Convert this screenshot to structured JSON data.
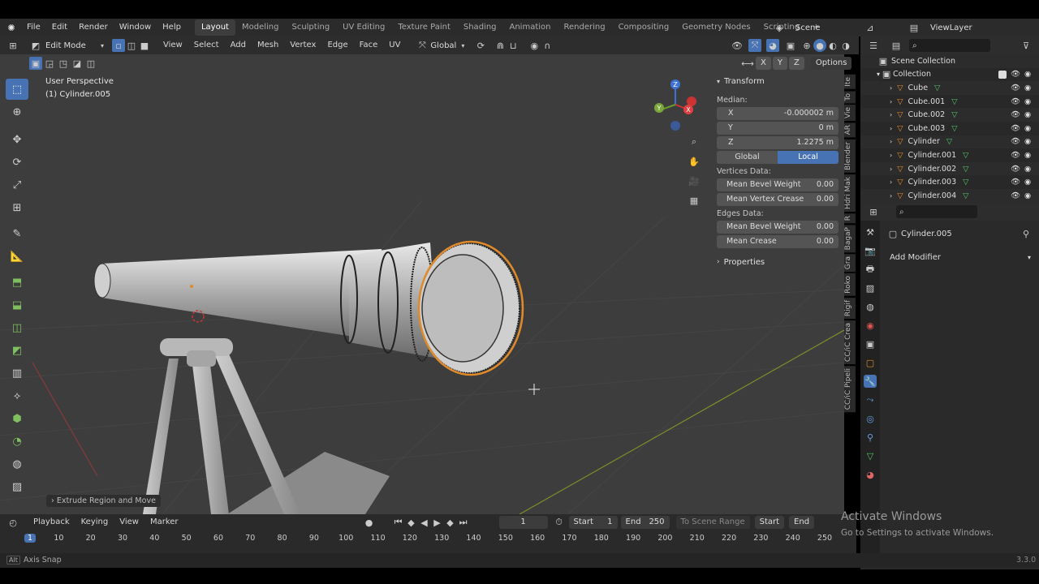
{
  "topbar": {
    "menus": [
      "File",
      "Edit",
      "Render",
      "Window",
      "Help"
    ],
    "workspaces": [
      "Layout",
      "Modeling",
      "Sculpting",
      "UV Editing",
      "Texture Paint",
      "Shading",
      "Animation",
      "Rendering",
      "Compositing",
      "Geometry Nodes",
      "Scripting"
    ],
    "active_workspace": "Layout",
    "add_icon": "+",
    "scene": "Scene",
    "view_layer": "ViewLayer"
  },
  "viewport_header": {
    "mode": "Edit Mode",
    "menus": [
      "View",
      "Select",
      "Add",
      "Mesh",
      "Vertex",
      "Edge",
      "Face",
      "UV"
    ],
    "orientation": "Global",
    "options": "Options",
    "axes": [
      "X",
      "Y",
      "Z"
    ]
  },
  "viewport": {
    "perspective": "User Perspective",
    "object": "(1) Cylinder.005",
    "last_op": "Extrude Region and Move",
    "gizmo_labels": [
      "Z",
      "Y",
      "X"
    ]
  },
  "npanel": {
    "title": "Transform",
    "median_label": "Median:",
    "median": [
      {
        "axis": "X",
        "value": "-0.000002 m"
      },
      {
        "axis": "Y",
        "value": "0 m"
      },
      {
        "axis": "Z",
        "value": "1.2275 m"
      }
    ],
    "space": [
      "Global",
      "Local"
    ],
    "active_space": "Local",
    "vertices_label": "Vertices Data:",
    "vertices": [
      {
        "label": "Mean Bevel Weight",
        "value": "0.00"
      },
      {
        "label": "Mean Vertex Crease",
        "value": "0.00"
      }
    ],
    "edges_label": "Edges Data:",
    "edges": [
      {
        "label": "Mean Bevel Weight",
        "value": "0.00"
      },
      {
        "label": "Mean Crease",
        "value": "0.00"
      }
    ],
    "properties": "Properties"
  },
  "side_tabs": [
    "Ite",
    "To",
    "Vie",
    "AR",
    "Blender",
    "Hdri Mak",
    "R",
    "BagaP",
    "Gra",
    "Roko",
    "Rigif",
    "CC/iC Crea",
    "CC/iC Pipeli"
  ],
  "outliner": {
    "scene_collection": "Scene Collection",
    "collection": "Collection",
    "items": [
      "Cube",
      "Cube.001",
      "Cube.002",
      "Cube.003",
      "Cylinder",
      "Cylinder.001",
      "Cylinder.002",
      "Cylinder.003",
      "Cylinder.004"
    ]
  },
  "properties": {
    "object": "Cylinder.005",
    "add_modifier": "Add Modifier"
  },
  "timeline": {
    "menus": [
      "Playback",
      "Keying",
      "View",
      "Marker"
    ],
    "current_frame": "1",
    "start_label": "Start",
    "start": "1",
    "end_label": "End",
    "end": "250",
    "to_scene_range": "To Scene Range",
    "start_btn": "Start",
    "end_btn": "End",
    "ticks": [
      "1",
      "10",
      "20",
      "30",
      "40",
      "50",
      "60",
      "70",
      "80",
      "90",
      "100",
      "110",
      "120",
      "130",
      "140",
      "150",
      "160",
      "170",
      "180",
      "190",
      "200",
      "210",
      "220",
      "230",
      "240",
      "250"
    ]
  },
  "status": {
    "hint": "Axis Snap",
    "alt_key": "Alt",
    "version": "3.3.0"
  },
  "watermark": {
    "title": "Activate Windows",
    "subtitle": "Go to Settings to activate Windows."
  },
  "colors": {
    "accent": "#4772b3",
    "selection": "#e08a2a",
    "bg_viewport": "#3d3d3d",
    "frame_highlight": "#4772b3"
  }
}
